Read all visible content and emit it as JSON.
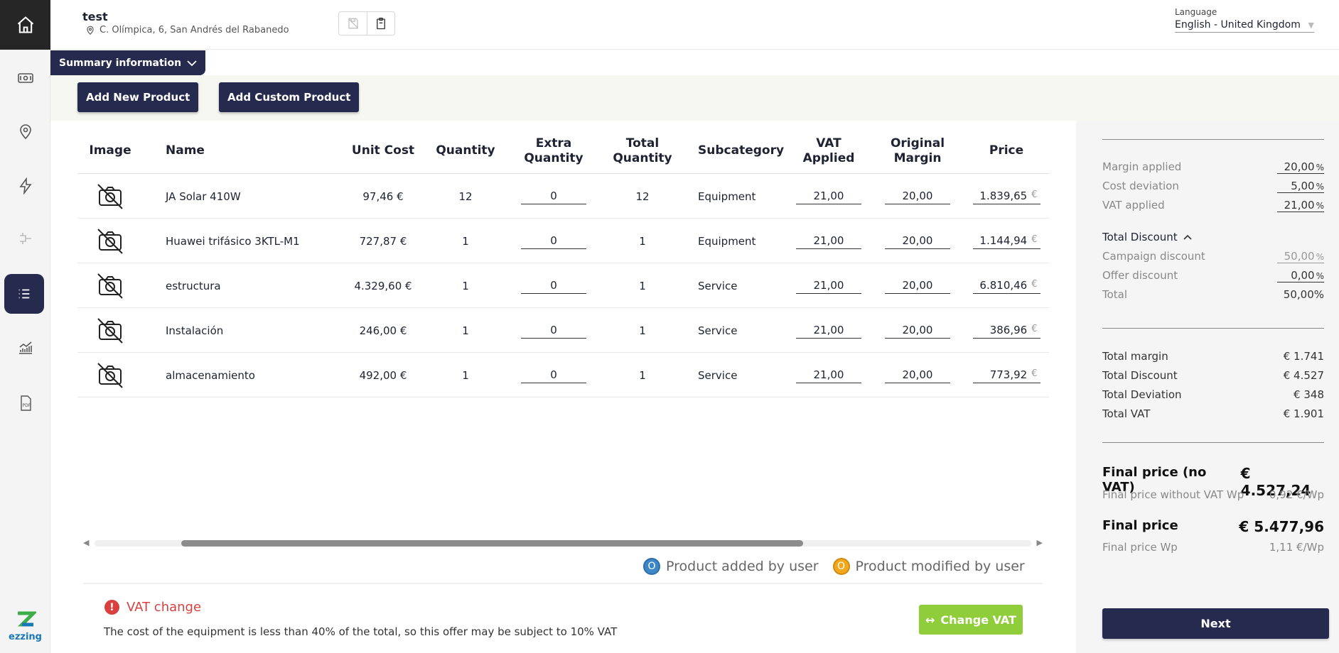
{
  "header": {
    "project_name": "test",
    "address": "C. Olímpica, 6, San Andrés del Rabanedo",
    "language_label": "Language",
    "language_value": "English - United Kingdom"
  },
  "summary_button": "Summary information",
  "actions": {
    "add_new_product": "Add New Product",
    "add_custom_product": "Add Custom Product"
  },
  "table": {
    "headers": {
      "image": "Image",
      "name": "Name",
      "unit_cost": "Unit Cost",
      "quantity": "Quantity",
      "extra_quantity_1": "Extra",
      "extra_quantity_2": "Quantity",
      "total_quantity_1": "Total",
      "total_quantity_2": "Quantity",
      "subcategory": "Subcategory",
      "vat_applied_1": "VAT",
      "vat_applied_2": "Applied",
      "original_margin_1": "Original",
      "original_margin_2": "Margin",
      "price": "Price"
    },
    "currency_symbol": "€",
    "rows": [
      {
        "name": "JA Solar 410W",
        "unit_cost": "97,46 €",
        "quantity": "12",
        "extra_quantity": "0",
        "total_quantity": "12",
        "subcategory": "Equipment",
        "vat": "21,00",
        "margin": "20,00",
        "price": "1.839,65"
      },
      {
        "name": "Huawei trifásico 3KTL-M1",
        "unit_cost": "727,87 €",
        "quantity": "1",
        "extra_quantity": "0",
        "total_quantity": "1",
        "subcategory": "Equipment",
        "vat": "21,00",
        "margin": "20,00",
        "price": "1.144,94"
      },
      {
        "name": "estructura",
        "unit_cost": "4.329,60 €",
        "quantity": "1",
        "extra_quantity": "0",
        "total_quantity": "1",
        "subcategory": "Service",
        "vat": "21,00",
        "margin": "20,00",
        "price": "6.810,46"
      },
      {
        "name": "Instalación",
        "unit_cost": "246,00 €",
        "quantity": "1",
        "extra_quantity": "0",
        "total_quantity": "1",
        "subcategory": "Service",
        "vat": "21,00",
        "margin": "20,00",
        "price": "386,96"
      },
      {
        "name": "almacenamiento",
        "unit_cost": "492,00 €",
        "quantity": "1",
        "extra_quantity": "0",
        "total_quantity": "1",
        "subcategory": "Service",
        "vat": "21,00",
        "margin": "20,00",
        "price": "773,92"
      }
    ]
  },
  "legend": {
    "added_marker": "O",
    "added_label": "Product added by user",
    "added_color": "#3d87c9",
    "modified_marker": "O",
    "modified_label": "Product modified by user",
    "modified_color": "#f2a81d"
  },
  "vat_notice": {
    "icon": "!",
    "title": "VAT change",
    "description": "The cost of the equipment is less than 40% of the total, so this offer may be subject to 10% VAT",
    "button": "Change VAT"
  },
  "summary_panel": {
    "margin_applied_label": "Margin applied",
    "margin_applied_value": "20,00",
    "cost_deviation_label": "Cost deviation",
    "cost_deviation_value": "5,00",
    "vat_applied_label": "VAT applied",
    "vat_applied_value": "21,00",
    "percent_symbol": "%",
    "total_discount_header": "Total Discount",
    "campaign_discount_label": "Campaign discount",
    "campaign_discount_value": "50,00",
    "offer_discount_label": "Offer discount",
    "offer_discount_value": "0,00",
    "total_label": "Total",
    "total_value": "50,00%",
    "total_margin_label": "Total margin",
    "total_margin_value": "€ 1.741",
    "total_discount_label": "Total Discount",
    "total_discount_value": "€ 4.527",
    "total_deviation_label": "Total Deviation",
    "total_deviation_value": "€ 348",
    "total_vat_label": "Total VAT",
    "total_vat_value": "€ 1.901",
    "final_price_novat_label": "Final price (no VAT)",
    "final_price_novat_value": "€ 4.527,24",
    "final_price_novat_wp_label": "Final price without VAT Wp",
    "final_price_novat_wp_value": "0,92 €/Wp",
    "final_price_label": "Final price",
    "final_price_value": "€ 5.477,96",
    "final_price_wp_label": "Final price Wp",
    "final_price_wp_value": "1,11 €/Wp",
    "next_button": "Next"
  },
  "sidebar": {
    "logo_text": "ezzing",
    "icons": [
      "home-icon",
      "money-icon",
      "location-icon",
      "lightning-icon",
      "connector-icon",
      "list-icon",
      "chart-icon",
      "pdf-icon"
    ]
  }
}
